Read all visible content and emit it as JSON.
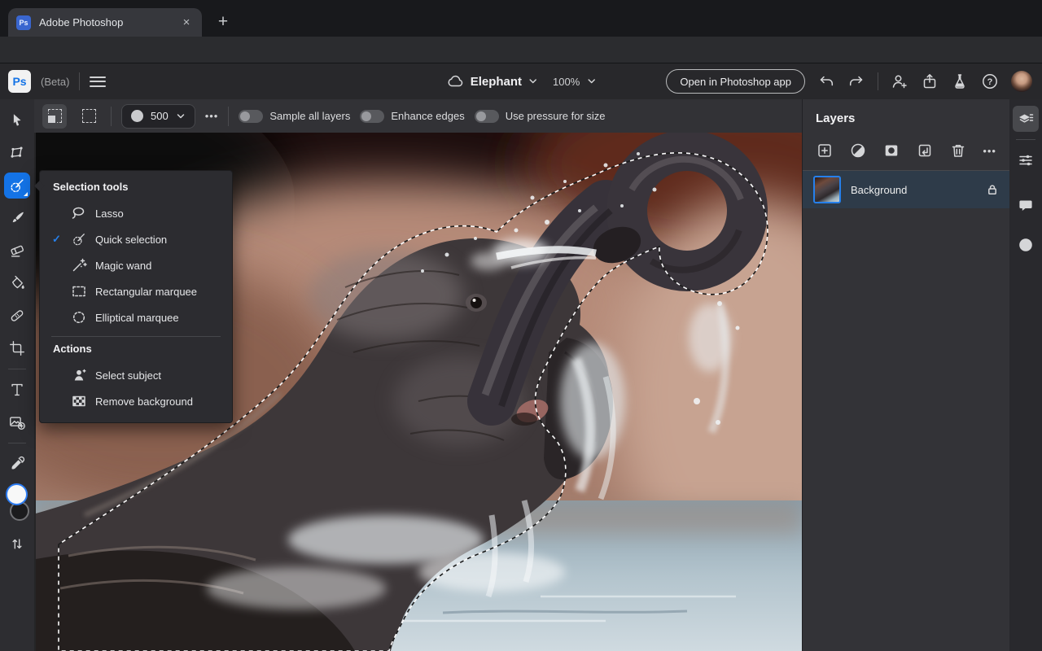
{
  "browser": {
    "tab_title": "Adobe Photoshop",
    "favicon_text": "Ps",
    "close_glyph": "×",
    "new_tab_glyph": "+",
    "url": "https://photoshop.adobe.com"
  },
  "header": {
    "logo_text": "Ps",
    "beta": "(Beta)",
    "doc_name": "Elephant",
    "zoom": "100%",
    "open_button": "Open in Photoshop app"
  },
  "icons": {
    "help_glyph": "?"
  },
  "options": {
    "brush_size": "500",
    "more_glyph": "•••",
    "toggles": [
      {
        "label": "Sample all layers",
        "on": false
      },
      {
        "label": "Enhance edges",
        "on": false
      },
      {
        "label": "Use pressure for size",
        "on": false
      }
    ]
  },
  "menu": {
    "title": "Selection tools",
    "check_glyph": "✓",
    "items": [
      {
        "label": "Lasso",
        "checked": false
      },
      {
        "label": "Quick selection",
        "checked": true
      },
      {
        "label": "Magic wand",
        "checked": false
      },
      {
        "label": "Rectangular marquee",
        "checked": false
      },
      {
        "label": "Elliptical marquee",
        "checked": false
      }
    ],
    "actions_title": "Actions",
    "actions": [
      {
        "label": "Select subject"
      },
      {
        "label": "Remove background"
      }
    ]
  },
  "layers": {
    "title": "Layers",
    "more_glyph": "•••",
    "rows": [
      {
        "name": "Background",
        "locked": true,
        "selected": true
      }
    ]
  },
  "colors": {
    "accent_blue": "#1473e6",
    "selected_layer_row": "#2e3b49",
    "canvas_water": "#b3c4cd"
  }
}
